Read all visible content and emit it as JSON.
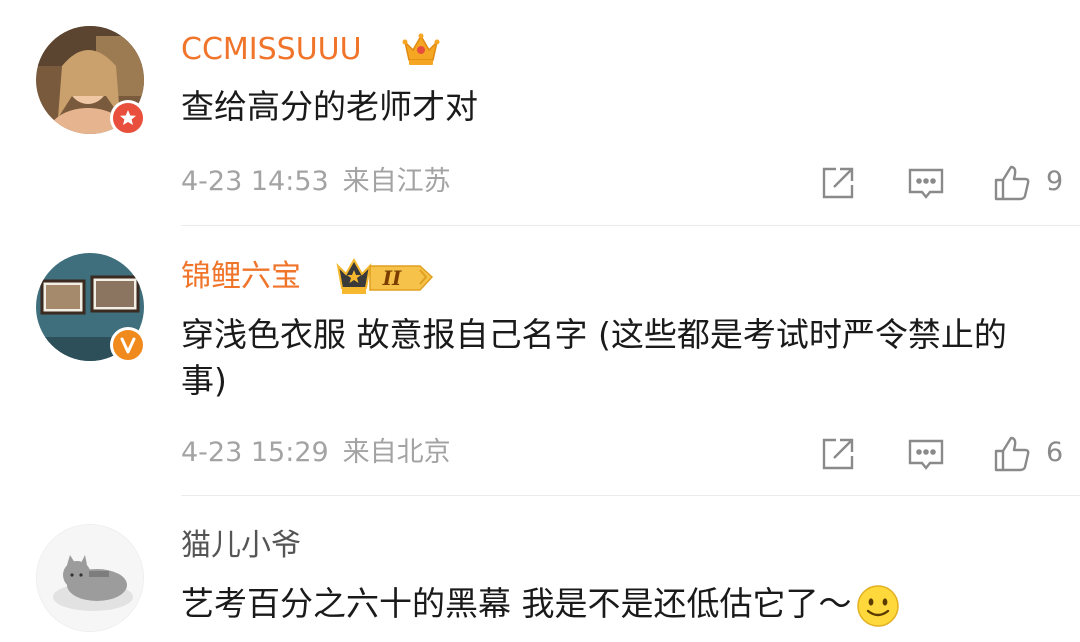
{
  "comments": [
    {
      "username": "CCMISSUUU",
      "text": "查给高分的老师才对",
      "time": "4-23 14:53",
      "location": "来自江苏",
      "likes": "9"
    },
    {
      "username": "锦鲤六宝",
      "level_badge": "II",
      "text": "穿浅色衣服 故意报自己名字 (这些都是考试时严令禁止的事)",
      "time": "4-23 15:29",
      "location": "来自北京",
      "likes": "6"
    },
    {
      "username": "猫儿小爷",
      "text": "艺考百分之六十的黑幕 我是不是还低估它了～"
    }
  ],
  "colors": {
    "vip_username": "#f0742a",
    "meta_gray": "#a3a3a3",
    "badge_red": "#e8503d",
    "badge_orange": "#f08a1c"
  },
  "icons": [
    "crown-icon",
    "level-crown-icon",
    "repost-icon",
    "comment-icon",
    "like-icon",
    "smile-emoji-icon"
  ]
}
